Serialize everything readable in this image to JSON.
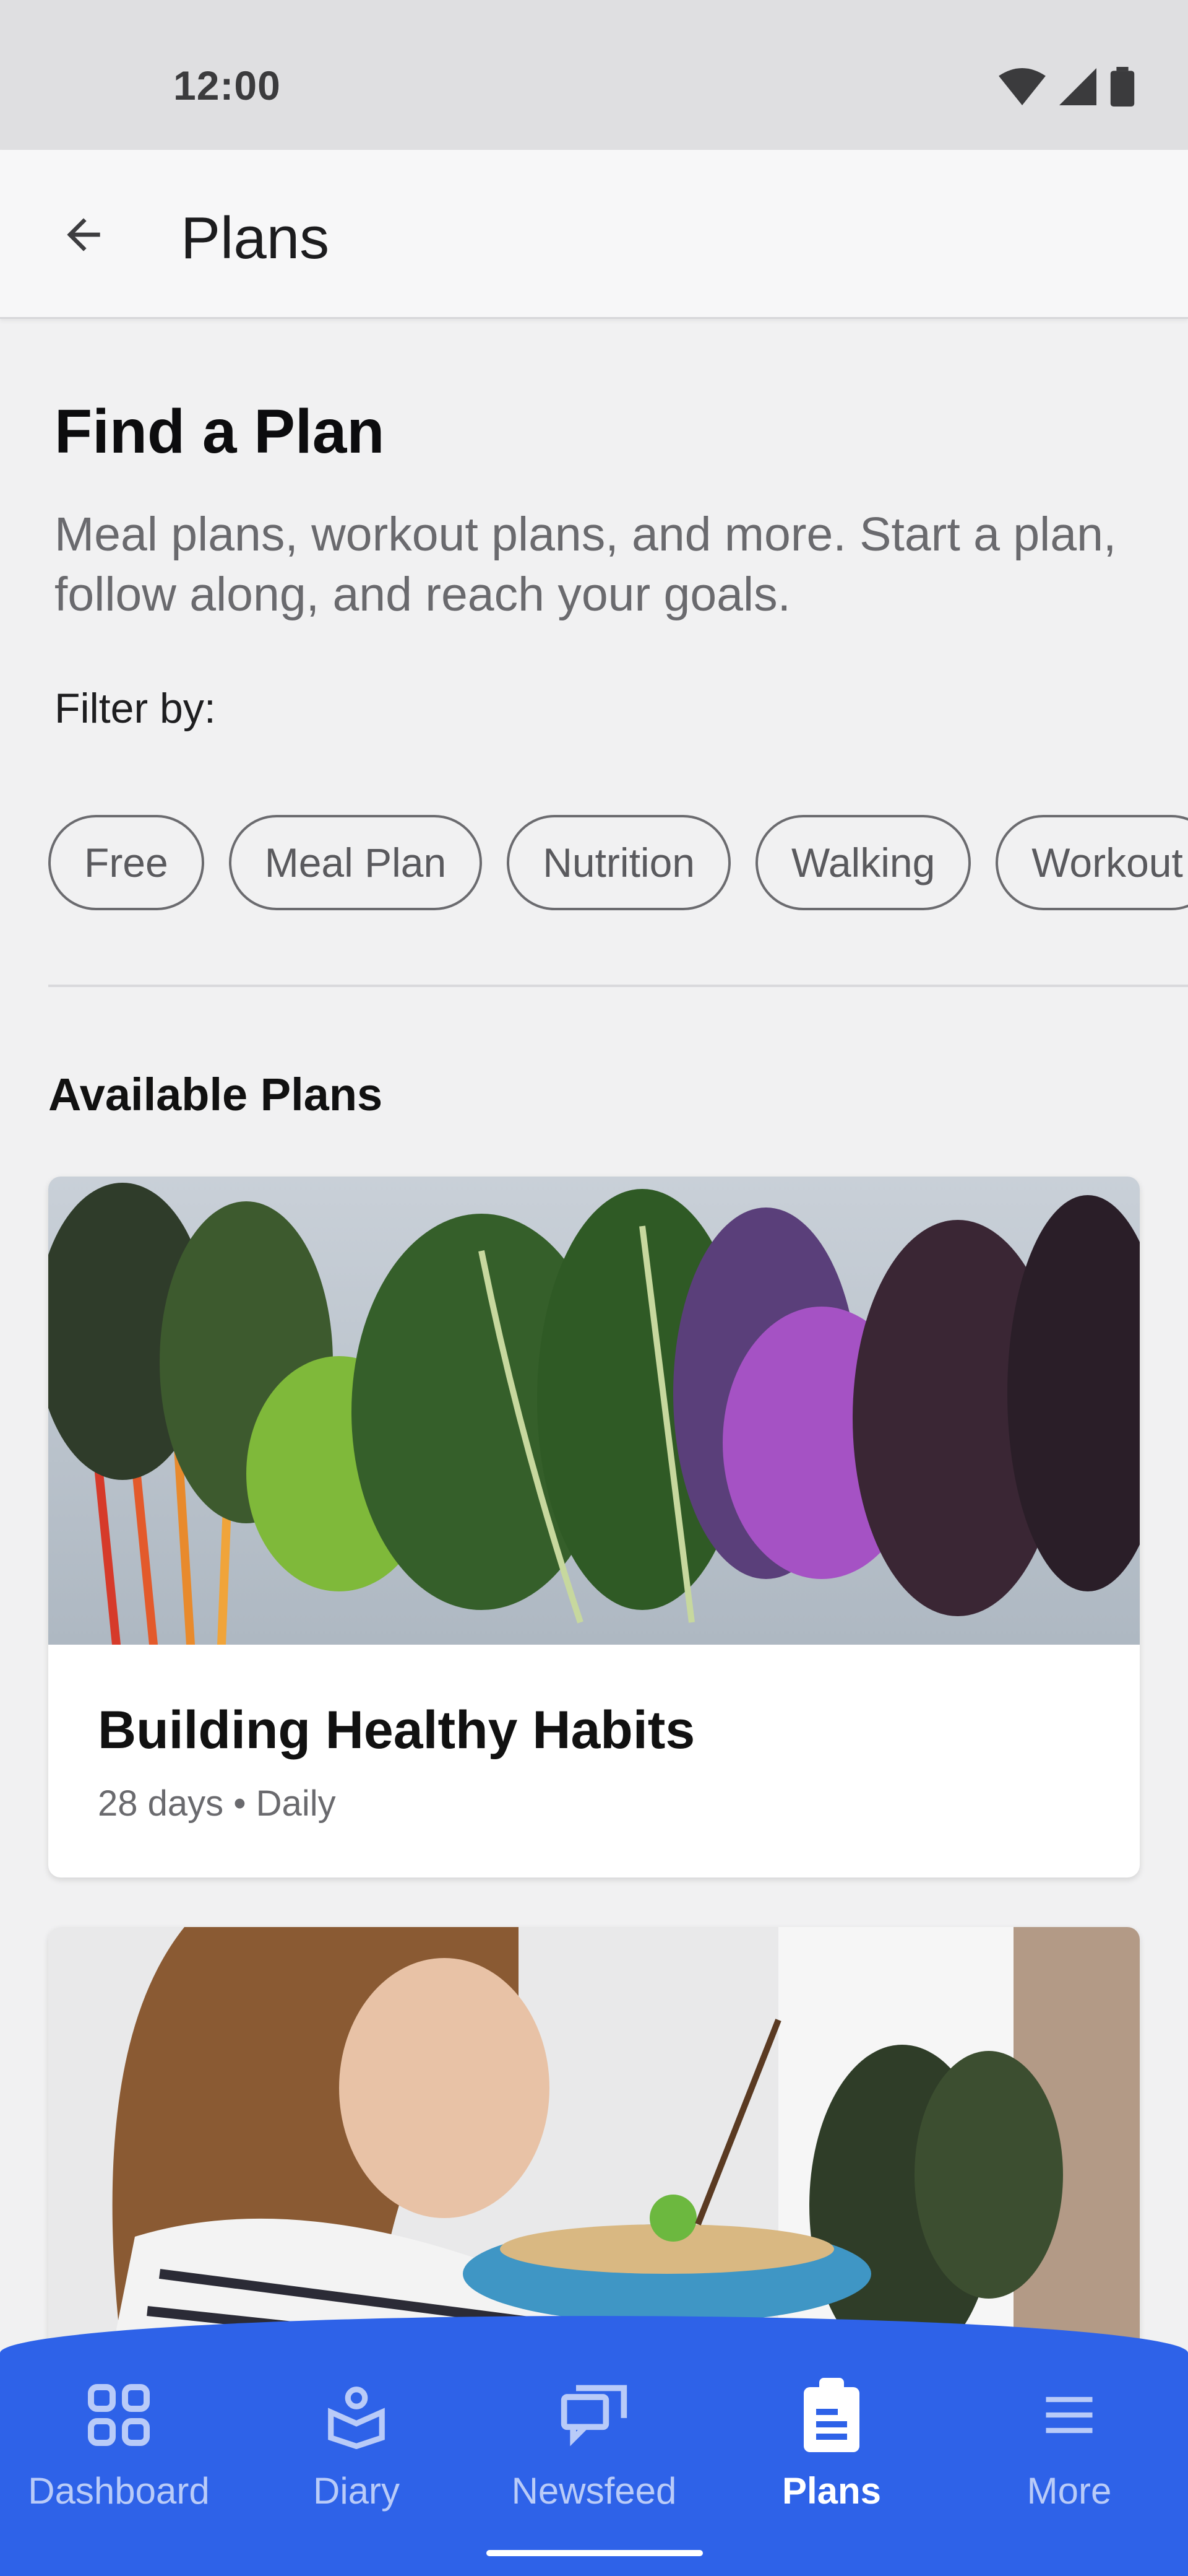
{
  "status_bar": {
    "time": "12:00"
  },
  "app_bar": {
    "title": "Plans"
  },
  "intro": {
    "heading": "Find a Plan",
    "description": "Meal plans, workout plans, and more. Start a plan, follow along, and reach your goals."
  },
  "filters": {
    "label": "Filter by:",
    "chips": [
      "Free",
      "Meal Plan",
      "Nutrition",
      "Walking",
      "Workout"
    ]
  },
  "available": {
    "title": "Available Plans",
    "plans": [
      {
        "title": "Building Healthy Habits",
        "meta": "28 days • Daily"
      }
    ]
  },
  "bottom_nav": {
    "items": [
      {
        "label": "Dashboard",
        "icon": "dashboard-icon"
      },
      {
        "label": "Diary",
        "icon": "diary-icon"
      },
      {
        "label": "Newsfeed",
        "icon": "newsfeed-icon"
      },
      {
        "label": "Plans",
        "icon": "plans-icon",
        "active": true
      },
      {
        "label": "More",
        "icon": "menu-icon"
      }
    ]
  },
  "colors": {
    "accent": "#2e62e8",
    "background": "#f1f1f2"
  }
}
